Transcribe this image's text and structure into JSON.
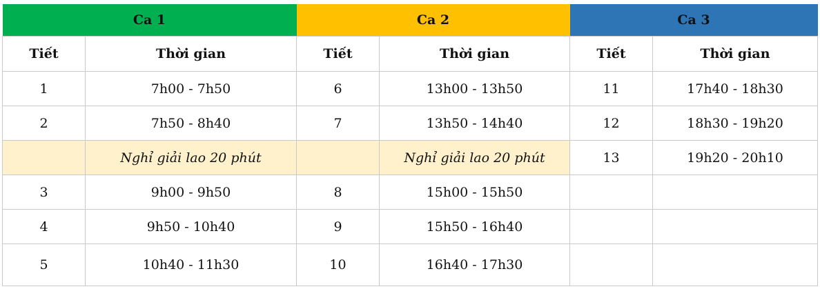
{
  "shifts": [
    {
      "title": "Ca 1",
      "color": "#00b050"
    },
    {
      "title": "Ca 2",
      "color": "#ffc000"
    },
    {
      "title": "Ca 3",
      "color": "#2e75b6"
    }
  ],
  "columns": {
    "period": "Tiết",
    "time": "Thời gian"
  },
  "break_label": "Nghỉ giải lao 20 phút",
  "break_color": "#fff1cc",
  "rows": [
    {
      "c1_p": "1",
      "c1_t": "7h00 - 7h50",
      "c2_p": "6",
      "c2_t": "13h00 - 13h50",
      "c3_p": "11",
      "c3_t": "17h40 - 18h30"
    },
    {
      "c1_p": "2",
      "c1_t": "7h50 - 8h40",
      "c2_p": "7",
      "c2_t": "13h50 - 14h40",
      "c3_p": "12",
      "c3_t": "18h30 - 19h20"
    },
    {
      "c1_p": "",
      "c1_t": "",
      "c2_p": "",
      "c2_t": "",
      "c3_p": "13",
      "c3_t": "19h20 - 20h10"
    },
    {
      "c1_p": "3",
      "c1_t": "9h00 - 9h50",
      "c2_p": "8",
      "c2_t": "15h00 - 15h50",
      "c3_p": "",
      "c3_t": ""
    },
    {
      "c1_p": "4",
      "c1_t": "9h50 - 10h40",
      "c2_p": "9",
      "c2_t": "15h50 - 16h40",
      "c3_p": "",
      "c3_t": ""
    },
    {
      "c1_p": "5",
      "c1_t": "10h40 - 11h30",
      "c2_p": "10",
      "c2_t": "16h40 - 17h30",
      "c3_p": "",
      "c3_t": ""
    }
  ]
}
